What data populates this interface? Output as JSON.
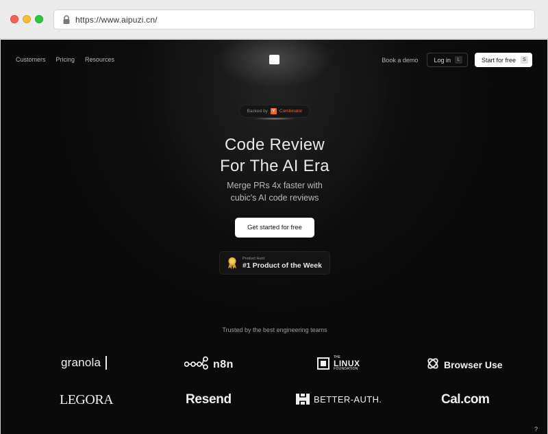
{
  "browser": {
    "url": "https://www.aipuzi.cn/"
  },
  "nav": {
    "links": [
      "Customers",
      "Pricing",
      "Resources"
    ],
    "book_demo": "Book a demo",
    "login_label": "Log in",
    "login_key": "L",
    "start_label": "Start for free",
    "start_key": "S"
  },
  "backed": {
    "prefix": "Backed by",
    "yc_letter": "Y",
    "yc_name": "Combinator"
  },
  "hero": {
    "title_line1": "Code Review",
    "title_line2": "For The AI Era",
    "subtitle_line1": "Merge PRs 4x faster with",
    "subtitle_line2": "cubic's AI code reviews",
    "cta_label": "Get started for free"
  },
  "product_hunt": {
    "small": "Product Hunt",
    "big": "#1 Product of the Week"
  },
  "trusted": {
    "heading": "Trusted by the best engineering teams",
    "logos": {
      "granola": "granola",
      "n8n": "n8n",
      "linux_the": "THE",
      "linux_name": "LINUX",
      "linux_foundation": "FOUNDATION",
      "browser_use": "Browser Use",
      "legora": "LEGORA",
      "resend": "Resend",
      "better_auth": "BETTER-AUTH.",
      "cal": "Cal.com"
    }
  },
  "colors": {
    "background": "#0a0a0a",
    "yc_orange": "#f26522",
    "text": "#e8e8e8"
  },
  "corner_label": "?"
}
